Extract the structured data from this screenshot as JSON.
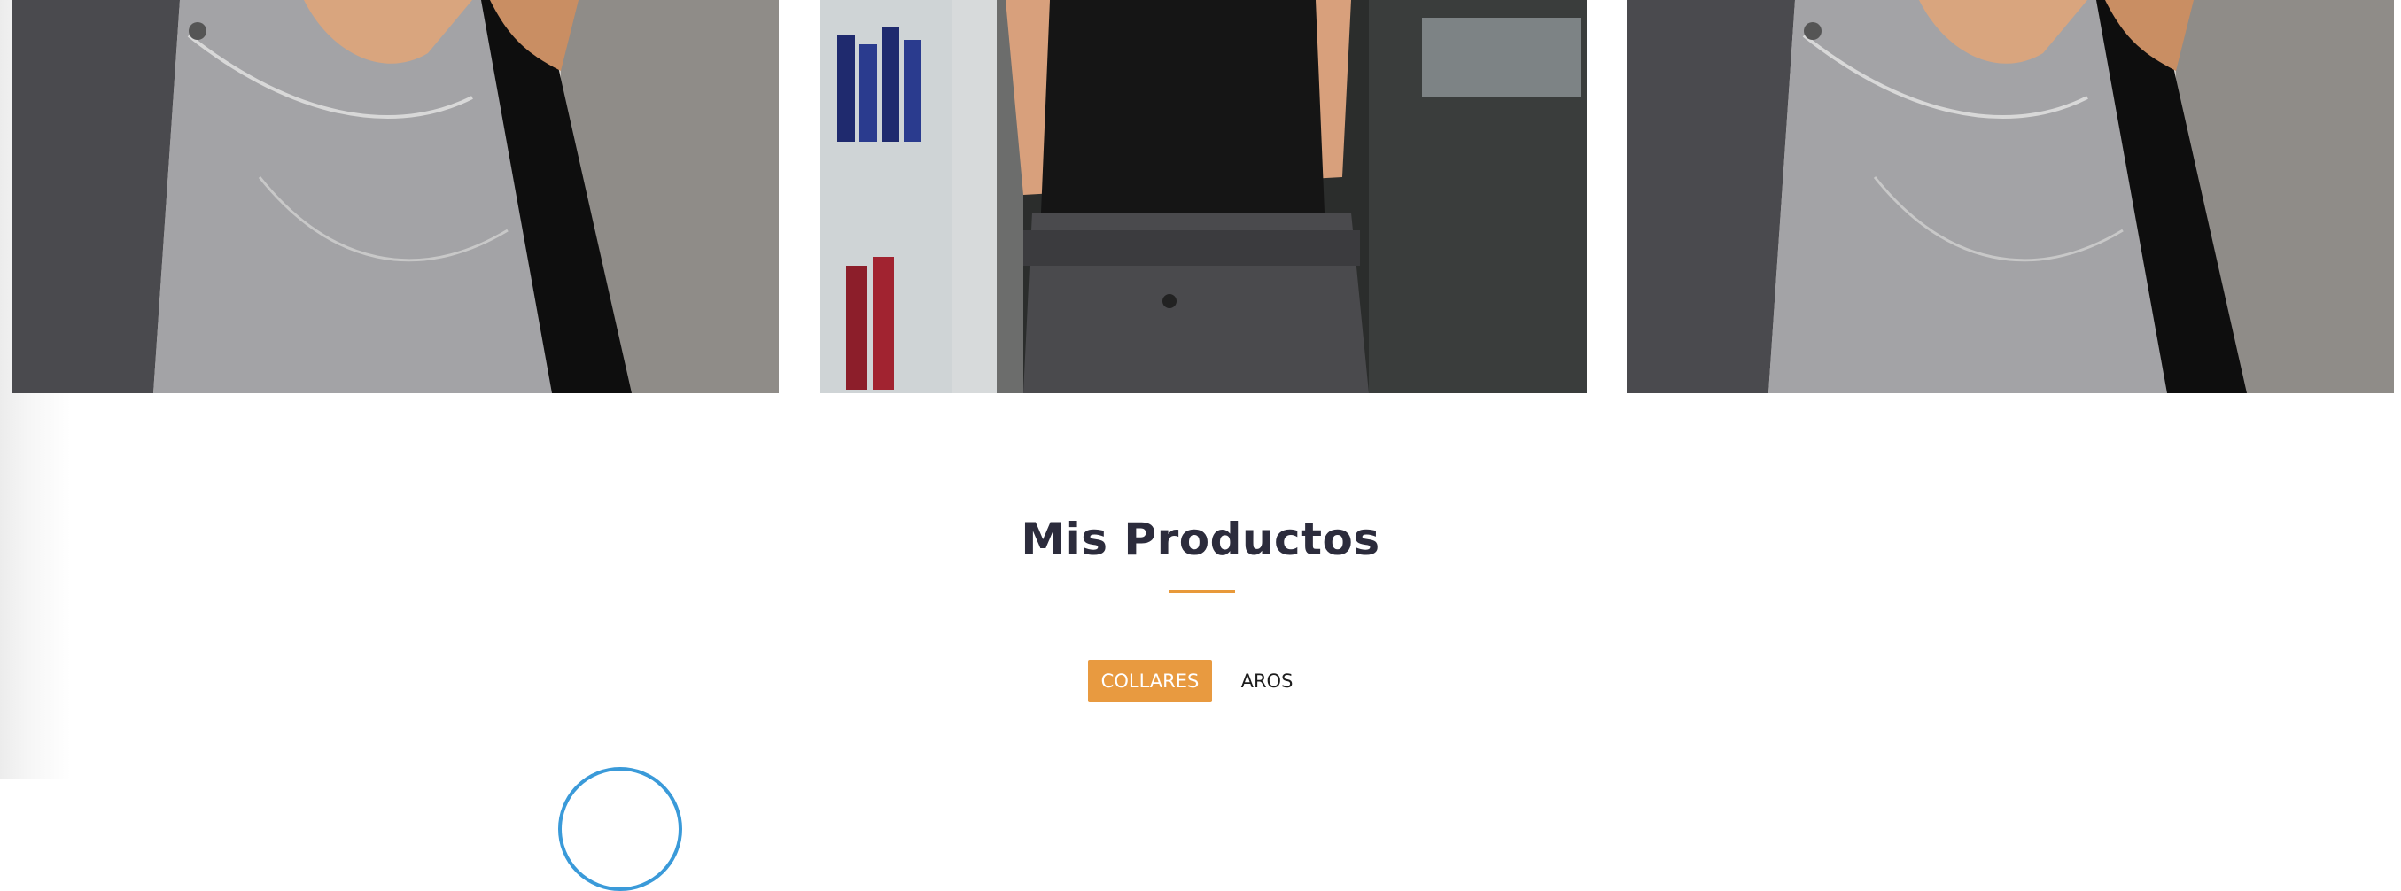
{
  "gallery": {
    "images": [
      {
        "name": "photo-jeans-pocket-left",
        "description_icon": "photo-icon"
      },
      {
        "name": "photo-store-aisle",
        "description_icon": "photo-icon"
      },
      {
        "name": "photo-jeans-pocket-right",
        "description_icon": "photo-icon"
      }
    ]
  },
  "products_section": {
    "title": "Mis Productos",
    "accent_color": "#e89a40",
    "tabs": [
      {
        "label": "COLLARES",
        "active": true
      },
      {
        "label": "AROS",
        "active": false
      }
    ]
  }
}
